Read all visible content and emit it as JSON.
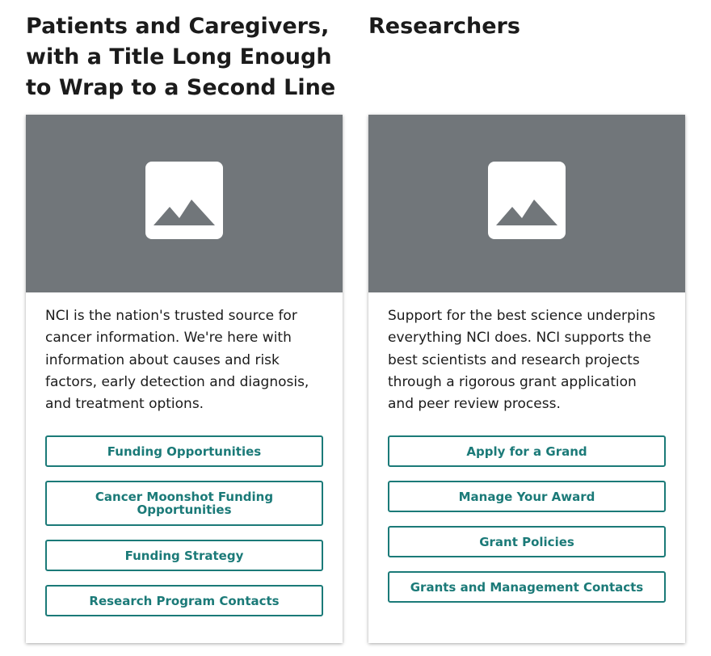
{
  "columns": [
    {
      "title": "Patients and Caregivers, with a Title Long Enough to Wrap to a Second Line",
      "image_icon": "image-placeholder-icon",
      "description": "NCI is the nation's trusted source for cancer information. We're here with information about causes and risk factors, early detection and diagnosis, and treatment options.",
      "buttons": [
        "Funding Opportunities",
        "Cancer Moonshot Funding Opportunities",
        "Funding Strategy",
        "Research Program Contacts"
      ]
    },
    {
      "title": "Researchers",
      "image_icon": "image-placeholder-icon",
      "description": "Support for the best science underpins everything NCI does. NCI supports the best scientists and research projects through a rigorous grant application and peer review process.",
      "buttons": [
        "Apply for a Grand",
        "Manage Your Award",
        "Grant Policies",
        "Grants and Management Contacts"
      ]
    }
  ],
  "colors": {
    "accent": "#1b7a78",
    "image_bg": "#71767a",
    "text": "#1b1b1b"
  }
}
